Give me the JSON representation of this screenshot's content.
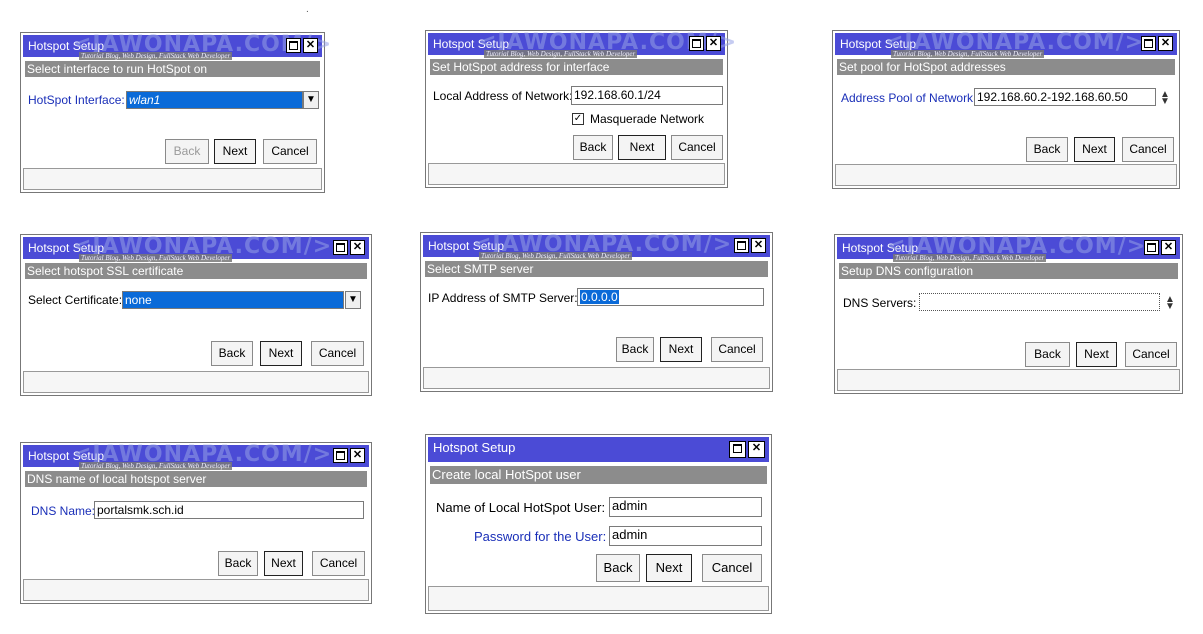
{
  "stray_mark": ".",
  "colors": {
    "titlebar": "#4b4bd6",
    "subheader": "#8c8c8c",
    "selection": "#0a6ad8",
    "label_blue": "#1a2fb8"
  },
  "common": {
    "title": "Hotspot Setup",
    "watermark": "<JAWONAPA.COM/>",
    "watermark_sub": "Tutorial Blog, Web Design, FullStack Web Developer",
    "back_label": "Back",
    "next_label": "Next",
    "cancel_label": "Cancel",
    "max_icon": "maximize-icon",
    "close_icon": "close-icon",
    "close_glyph": "✕"
  },
  "dialogs": {
    "interface": {
      "subtitle": "Select interface to run HotSpot on",
      "label": "HotSpot Interface:",
      "value": "wlan1"
    },
    "address": {
      "subtitle": "Set HotSpot address for interface",
      "label": "Local Address of Network:",
      "value": "192.168.60.1/24",
      "checkbox_label": "Masquerade Network",
      "checkbox_checked": true
    },
    "pool": {
      "subtitle": "Set pool for HotSpot addresses",
      "label": "Address Pool of Network:",
      "value": "192.168.60.2-192.168.60.50"
    },
    "ssl": {
      "subtitle": "Select hotspot SSL certificate",
      "label": "Select Certificate:",
      "value": "none"
    },
    "smtp": {
      "subtitle": "Select SMTP server",
      "label": "IP Address of SMTP Server:",
      "value": "0.0.0.0"
    },
    "dns": {
      "subtitle": "Setup DNS configuration",
      "label": "DNS Servers:",
      "value": ""
    },
    "dnsname": {
      "subtitle": "DNS name of local hotspot server",
      "label": "DNS Name:",
      "value": "portalsmk.sch.id"
    },
    "user": {
      "subtitle": "Create local HotSpot user",
      "name_label": "Name of Local HotSpot User:",
      "name_value": "admin",
      "password_label": "Password for the User:",
      "password_value": "admin"
    }
  }
}
